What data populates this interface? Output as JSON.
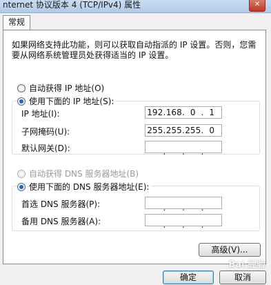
{
  "window": {
    "title": "nternet 协议版本 4 (TCP/IPv4) 属性",
    "close_glyph": "✕"
  },
  "tabs": [
    {
      "label": "常规"
    }
  ],
  "description": "如果网络支持此功能，则可以获取自动指派的 IP 设置。否则，您需要从网络系统管理员处获得适当的 IP 设置。",
  "ip_section": {
    "auto_label": "自动获得 IP 地址(O)",
    "manual_label": "使用下面的 IP 地址(S):",
    "selected": "manual",
    "fields": [
      {
        "label": "IP 地址(I):",
        "octets": [
          "192",
          "168",
          "0",
          "1"
        ]
      },
      {
        "label": "子网掩码(U):",
        "octets": [
          "255",
          "255",
          "255",
          "0"
        ]
      },
      {
        "label": "默认网关(D):",
        "octets": [
          "",
          "",
          "",
          ""
        ]
      }
    ]
  },
  "dns_section": {
    "auto_label": "自动获得 DNS 服务器地址(B)",
    "manual_label": "使用下面的 DNS 服务器地址(E):",
    "selected": "manual",
    "fields": [
      {
        "label": "首选 DNS 服务器(P):",
        "octets": [
          "",
          "",
          "",
          ""
        ]
      },
      {
        "label": "备用 DNS 服务器(A):",
        "octets": [
          "",
          "",
          "",
          ""
        ]
      }
    ]
  },
  "buttons": {
    "advanced": "高级(V)...",
    "ok": "确定",
    "cancel": "取消"
  },
  "watermark": "Bai 经验",
  "colors": {
    "titlebar": "#b3cbe8",
    "radio_selected": "#2a64b6",
    "default_button_border": "#3c7fb1"
  }
}
